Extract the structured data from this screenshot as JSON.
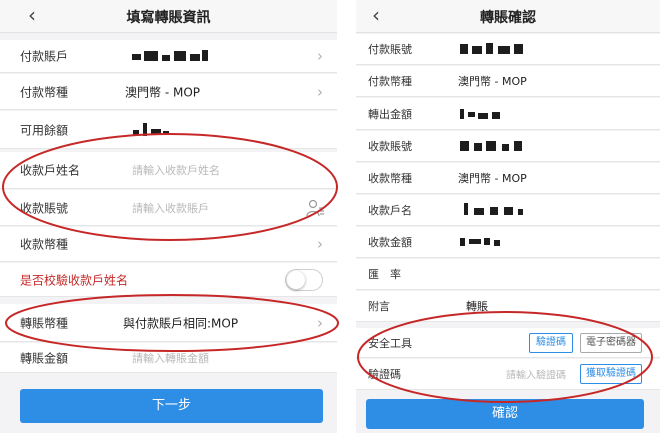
{
  "left": {
    "title": "填寫轉賬資訊",
    "back_glyph": "‹",
    "chevron_glyph": "›",
    "rows": {
      "pay_account": {
        "label": "付款賬戶"
      },
      "pay_currency": {
        "label": "付款幣種",
        "value": "澳門幣 - MOP"
      },
      "available_balance": {
        "label": "可用餘額"
      },
      "payee_name": {
        "label": "收款戶姓名",
        "placeholder": "請輸入收款戶姓名"
      },
      "payee_account": {
        "label": "收款賬號",
        "placeholder": "請輸入收款賬戶"
      },
      "payee_currency": {
        "label": "收款幣種"
      },
      "verify_name": {
        "label": "是否校驗收款戶姓名",
        "toggle_on": false
      },
      "transfer_currency": {
        "label": "轉賬幣種",
        "value": "與付款賬戶相同:MOP"
      },
      "transfer_amount": {
        "label": "轉賬金額",
        "placeholder": "請輸入轉賬金額"
      }
    },
    "next_button": "下一步"
  },
  "right": {
    "title": "轉賬確認",
    "back_glyph": "‹",
    "rows": {
      "pay_account": {
        "label": "付款賬號"
      },
      "pay_currency": {
        "label": "付款幣種",
        "value": "澳門幣 - MOP"
      },
      "transfer_out_amount": {
        "label": "轉出金額"
      },
      "payee_account": {
        "label": "收款賬號"
      },
      "payee_currency": {
        "label": "收款幣種",
        "value": "澳門幣 - MOP"
      },
      "payee_name": {
        "label": "收款戶名"
      },
      "payee_amount": {
        "label": "收款金額"
      },
      "exchange_rate": {
        "label": "匯　率"
      },
      "remark": {
        "label": "附言",
        "value": "轉賬"
      },
      "security_tool": {
        "label": "安全工具",
        "options": [
          "驗證碼",
          "電子密碼器"
        ],
        "selected": "驗證碼"
      },
      "otp": {
        "label": "驗證碼",
        "placeholder": "請輸入驗證碼",
        "get_code_button": "獲取驗證碼"
      }
    },
    "confirm_button": "確認"
  },
  "colors": {
    "accent_blue": "#2e8ee6",
    "annotation_red": "#c62828",
    "warning_label_red": "#c62828",
    "background": "#f3f3f5"
  }
}
